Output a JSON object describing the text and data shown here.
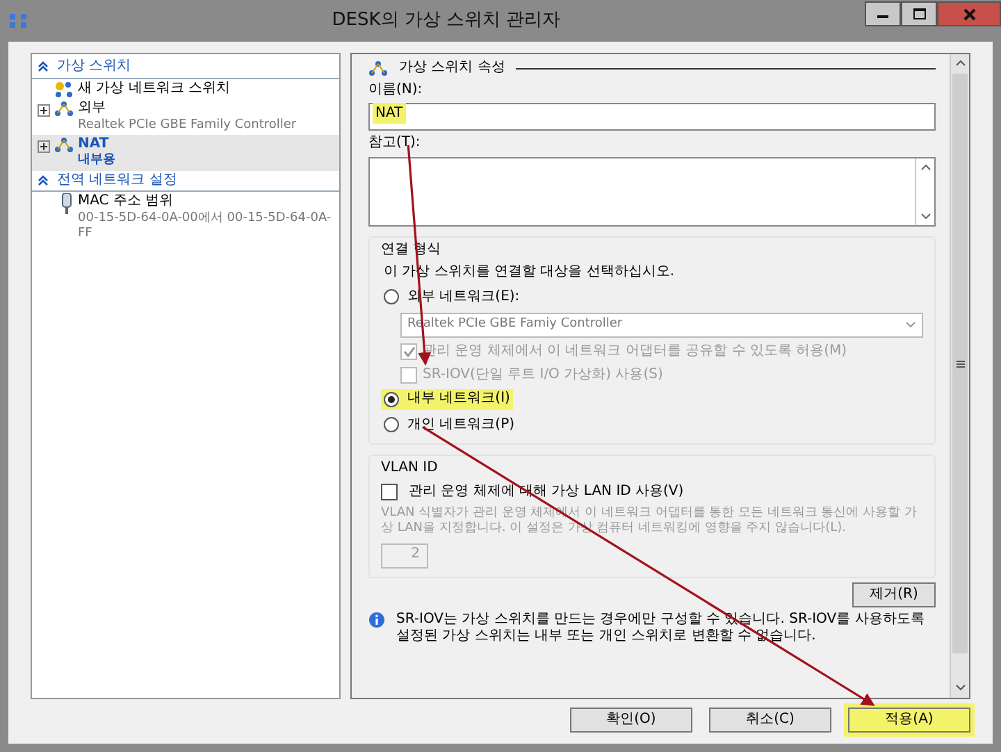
{
  "window": {
    "title": "DESK의 가상 스위치 관리자"
  },
  "sidebar": {
    "sections": [
      {
        "title": "가상 스위치",
        "expanded": true,
        "items": [
          {
            "kind": "new",
            "label": "새 가상 네트워크 스위치",
            "selected": false
          },
          {
            "kind": "switch",
            "label": "외부",
            "detail": "Realtek PCIe GBE Family Controller",
            "selected": false,
            "expanded": false
          },
          {
            "kind": "switch",
            "label": "NAT",
            "detail": "내부용",
            "selected": true,
            "expanded": false
          }
        ]
      },
      {
        "title": "전역 네트워크 설정",
        "expanded": true,
        "items": [
          {
            "kind": "mac",
            "label": "MAC 주소 범위",
            "detail": "00-15-5D-64-0A-00에서 00-15-5D-64-0A-FF",
            "selected": false
          }
        ]
      }
    ]
  },
  "properties": {
    "title": "가상 스위치 속성",
    "name_label": "이름(N):",
    "name_value": "NAT",
    "name_highlighted": true,
    "notes_label": "참고(T):",
    "connection": {
      "title": "연결 형식",
      "prompt": "이 가상 스위치를 연결할 대상을 선택하십시오.",
      "options": [
        {
          "kind": "radio",
          "label": "외부 네트워크(E):",
          "selected": false,
          "highlighted": false
        },
        {
          "kind": "select",
          "value": "Realtek PCIe GBE Famiy Controller",
          "disabled": true
        },
        {
          "kind": "checkbox",
          "label": "관리 운영 체제에서 이 네트워크 어댑터를 공유할 수 있도록 허용(M)",
          "checked": true,
          "disabled": true
        },
        {
          "kind": "checkbox",
          "label": "SR-IOV(단일 루트 I/O 가상화) 사용(S)",
          "checked": false,
          "disabled": true
        },
        {
          "kind": "radio",
          "label": "내부 네트워크(I)",
          "selected": true,
          "highlighted": true
        },
        {
          "kind": "radio",
          "label": "개인 네트워크(P)",
          "selected": false,
          "highlighted": false
        }
      ]
    },
    "vlan": {
      "title": "VLAN ID",
      "checkbox_label": "관리 운영 체제에 대해 가상 LAN ID 사용(V)",
      "checked": false,
      "description": "VLAN 식별자가 관리 운영 체제에서 이 네트워크 어댑터를 통한 모든 네트워크 통신에 사용할 가상 LAN을 지정합니다. 이 설정은 가상 컴퓨터 네트워킹에 영향을 주지 않습니다(L).",
      "value": "2",
      "disabled": true
    },
    "remove_button": "제거(R)",
    "info": "SR-IOV는 가상 스위치를 만드는 경우에만 구성할 수 있습니다. SR-IOV를 사용하도록 설정된 가상 스위치는 내부 또는 개인 스위치로 변환할 수 없습니다."
  },
  "buttons": [
    {
      "label": "확인(O)",
      "highlighted": false
    },
    {
      "label": "취소(C)",
      "highlighted": false
    },
    {
      "label": "적용(A)",
      "highlighted": true
    }
  ],
  "annotations": [
    {
      "kind": "arrow"
    },
    {
      "kind": "arrow"
    }
  ]
}
